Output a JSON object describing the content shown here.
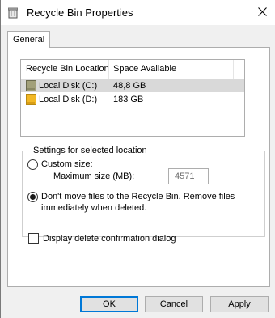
{
  "window": {
    "title": "Recycle Bin Properties",
    "title_icon": "recycle-bin-icon",
    "close_icon": "close-icon"
  },
  "tabs": [
    {
      "label": "General",
      "selected": true
    }
  ],
  "list": {
    "columns": [
      "Recycle Bin Location",
      "Space Available"
    ],
    "rows": [
      {
        "location": "Local Disk (C:)",
        "space": "48,8 GB",
        "icon": "system-drive-icon",
        "selected": true
      },
      {
        "location": "Local Disk (D:)",
        "space": "183 GB",
        "icon": "drive-icon",
        "selected": false
      }
    ]
  },
  "settings": {
    "group_label": "Settings for selected location",
    "custom_size_label": "Custom size:",
    "max_size_label": "Maximum size (MB):",
    "max_size_value": "4571",
    "dont_move_label_line1": "Don't move files to the Recycle Bin. Remove files",
    "dont_move_label_line2": "immediately when deleted.",
    "selected_option": "dont_move"
  },
  "confirm_dialog": {
    "label": "Display delete confirmation dialog",
    "checked": false
  },
  "buttons": {
    "ok": "OK",
    "cancel": "Cancel",
    "apply": "Apply"
  },
  "colors": {
    "accent": "#0078d7",
    "selected_row": "#d9d9d9"
  }
}
